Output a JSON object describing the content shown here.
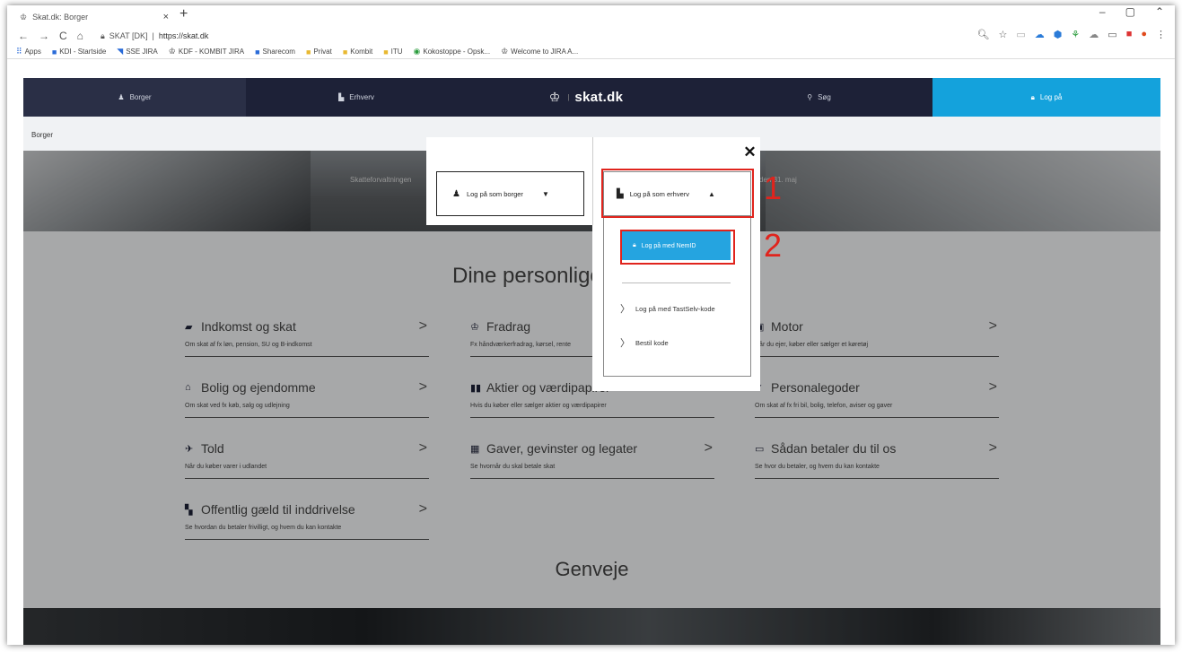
{
  "browser": {
    "tab_title": "Skat.dk: Borger",
    "tab_close": "×",
    "new_tab": "+",
    "window_buttons": [
      "–",
      "▢",
      "⌃"
    ],
    "nav_buttons": [
      "←",
      "→",
      "C",
      "⌂"
    ],
    "secure_label": "SKAT [DK]",
    "url": "https://skat.dk",
    "bookmarks": [
      {
        "label": "Apps",
        "icon": "apps-grid-icon"
      },
      {
        "label": "KDI - Startside",
        "icon": "kdi-icon"
      },
      {
        "label": "SSE JIRA",
        "icon": "jira-icon"
      },
      {
        "label": "KDF - KOMBIT JIRA",
        "icon": "kombit-icon"
      },
      {
        "label": "Sharecom",
        "icon": "sharecom-icon"
      },
      {
        "label": "Privat",
        "icon": "folder-icon"
      },
      {
        "label": "Kombit",
        "icon": "folder-icon"
      },
      {
        "label": "ITU",
        "icon": "folder-icon"
      },
      {
        "label": "Kokostoppe - Opsk...",
        "icon": "eye-icon"
      },
      {
        "label": "Welcome to JIRA A...",
        "icon": "kombit-icon"
      }
    ]
  },
  "site": {
    "nav": {
      "borger": "Borger",
      "erhverv": "Erhverv",
      "logo": "skat.dk",
      "search": "Søg",
      "login": "Log på"
    },
    "breadcrumb": "Borger",
    "hero_left_text": "Skatteforvaltningen",
    "hero_right_text": "den 31. maj",
    "section_title": "Dine personlige",
    "shortcuts_title": "Genveje",
    "cards": [
      {
        "title": "Indkomst og skat",
        "subtitle": "Om skat af fx løn, pension, SU og B-indkomst",
        "icon": "money-icon"
      },
      {
        "title": "Fradrag",
        "subtitle": "Fx håndværkerfradrag, kørsel, rente",
        "icon": "deduction-icon"
      },
      {
        "title": "Motor",
        "subtitle": "Når du ejer, køber eller sælger et køretøj",
        "icon": "car-icon"
      },
      {
        "title": "Bolig og ejendomme",
        "subtitle": "Om skat ved fx køb, salg og udlejning",
        "icon": "house-icon"
      },
      {
        "title": "Aktier og værdipapirer",
        "subtitle": "Hvis du køber eller sælger aktier og værdipapirer",
        "icon": "stocks-icon"
      },
      {
        "title": "Personalegoder",
        "subtitle": "Om skat af fx fri bil, bolig, telefon, aviser og gaver",
        "icon": "benefits-icon"
      },
      {
        "title": "Told",
        "subtitle": "Når du køber varer i udlandet",
        "icon": "plane-icon"
      },
      {
        "title": "Gaver, gevinster og legater",
        "subtitle": "Se hvornår du skal betale skat",
        "icon": "gift-icon"
      },
      {
        "title": "Sådan betaler du til os",
        "subtitle": "Se hvor du betaler, og hvem du kan kontakte",
        "icon": "payment-icon"
      },
      {
        "title": "Offentlig gæld til inddrivelse",
        "subtitle": "Se hvordan du betaler frivilligt, og hvem du kan kontakte",
        "icon": "debt-icon"
      }
    ],
    "card_arrow": ">"
  },
  "login_modal": {
    "borger_label": "Log på som borger",
    "borger_caret": "▼",
    "erhverv_label": "Log på som erhverv",
    "erhverv_caret": "▲",
    "nemid_label": "Log på med NemID",
    "tastselv_label": "Log på med TastSelv-kode",
    "bestil_label": "Bestil kode",
    "close": "✕"
  },
  "annotations": {
    "step1": "1",
    "step2": "2",
    "highlight_color": "#e0241d"
  },
  "colors": {
    "nav_bg": "#1d2137",
    "login_blue": "#14a2dc",
    "nemid_blue": "#25a4e0"
  }
}
